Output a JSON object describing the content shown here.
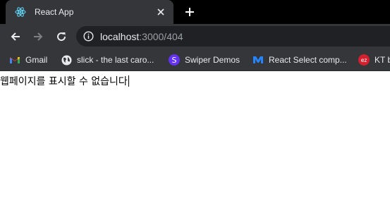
{
  "tab": {
    "title": "React App",
    "favicon": "react-icon"
  },
  "toolbar": {
    "url_host": "localhost",
    "url_path": ":3000/404"
  },
  "bookmarks": [
    {
      "label": "Gmail",
      "icon": "gmail-icon"
    },
    {
      "label": "slick - the last caro...",
      "icon": "globe-icon"
    },
    {
      "label": "Swiper Demos",
      "icon": "swiper-icon"
    },
    {
      "label": "React Select comp...",
      "icon": "react-select-icon"
    },
    {
      "label": "KT b",
      "icon": "ez-icon"
    }
  ],
  "page": {
    "message": "웹페이지를 표시할 수 없습니다"
  },
  "colors": {
    "tab_strip": "#000000",
    "toolbar": "#35363a",
    "omnibox": "#202124",
    "text_light": "#e8eaed",
    "text_dim": "#9aa0a6"
  }
}
